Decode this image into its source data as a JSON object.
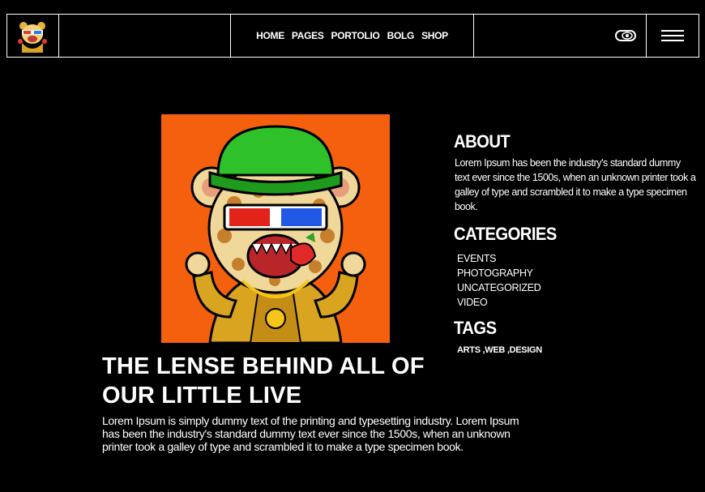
{
  "nav": {
    "items": [
      {
        "label": "HOME"
      },
      {
        "label": "PAGES"
      },
      {
        "label": "PORTOLIO"
      },
      {
        "label": "BOLG"
      },
      {
        "label": "SHOP"
      }
    ]
  },
  "icons": {
    "logo": "bear-mascot-logo",
    "view_toggle": "eye-icon",
    "menu": "hamburger-menu-icon",
    "hero": "bear-mascot-illustration"
  },
  "colors": {
    "background": "#000000",
    "hero_background": "#f4600e",
    "text": "#ffffff"
  },
  "main": {
    "title_line1": "THE LENSE BEHIND ALL OF",
    "title_line2": "OUR LITTLE LIVE",
    "body": "Lorem Ipsum is simply dummy text of the printing and typesetting industry. Lorem Ipsum has been the industry's standard dummy text ever since the 1500s, when an unknown printer took a galley of type and scrambled it to make a type specimen book."
  },
  "sidebar": {
    "about": {
      "heading": "ABOUT",
      "text": "Lorem Ipsum has been the industry's standard dummy text ever since the 1500s, when an unknown printer took a galley of type and scrambled it to make a type specimen book."
    },
    "categories": {
      "heading": "CATEGORIES",
      "items": [
        "EVENTS",
        "PHOTOGRAPHY",
        "UNCATEGORIZED",
        "VIDEO"
      ]
    },
    "tags": {
      "heading": "TAGS",
      "items": [
        "ARTS",
        "WEB",
        "DESIGN"
      ]
    }
  }
}
